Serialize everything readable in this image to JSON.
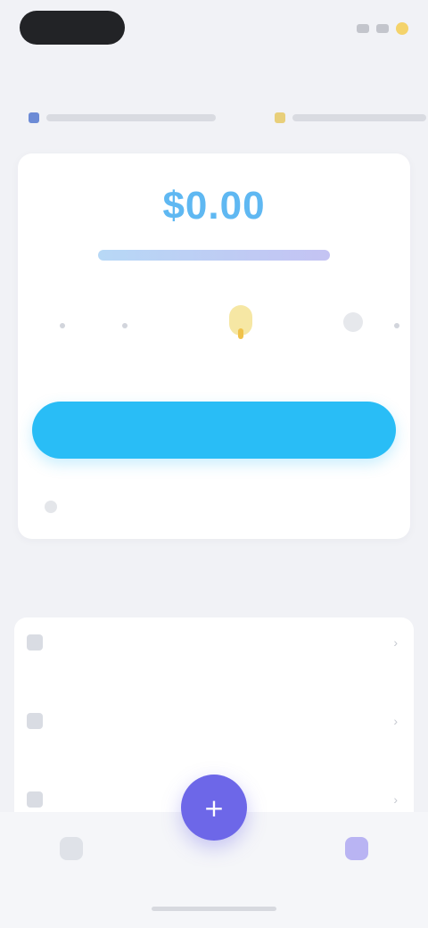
{
  "status_bar": {
    "pill_label": ""
  },
  "info_strip": {
    "left_text": "",
    "right_text": ""
  },
  "balance_card": {
    "balance": "$0.00",
    "subline": "",
    "steps": [
      {
        "label": ""
      },
      {
        "label": ""
      },
      {
        "label": ""
      },
      {
        "label": ""
      },
      {
        "label": ""
      }
    ],
    "note": "",
    "primary_button": "",
    "footer_text": ""
  },
  "section": {
    "title": "",
    "items": [
      {
        "label": ""
      },
      {
        "label": ""
      },
      {
        "label": ""
      }
    ]
  },
  "bottom_nav": {
    "items": [
      {
        "label": ""
      },
      {
        "label": ""
      }
    ],
    "fab_icon": "plus-icon"
  },
  "colors": {
    "background": "#f1f2f6",
    "card": "#ffffff",
    "balance_text": "#5fb8f2",
    "primary_button": "#29bdf6",
    "fab": "#6d67e8",
    "highlight": "#f6e7a4"
  }
}
